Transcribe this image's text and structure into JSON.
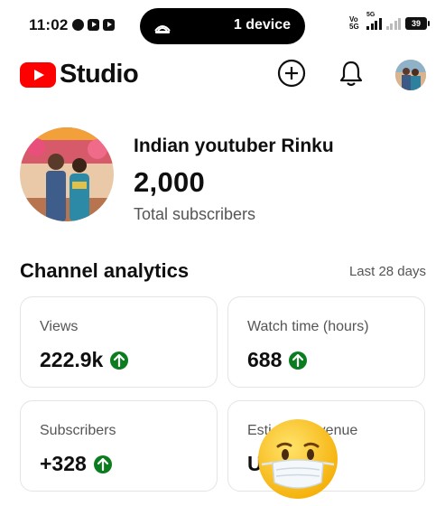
{
  "status_bar": {
    "time": "11:02",
    "cast_text": "1 device",
    "volte_label": "Vo\n5G R",
    "network_tag": "5G",
    "battery": "39"
  },
  "app": {
    "logo_text": "Studio",
    "brand_color": "#ff0000"
  },
  "channel": {
    "name": "Indian youtuber Rinku",
    "subscribers": "2,000",
    "subscribers_label": "Total subscribers"
  },
  "analytics": {
    "title": "Channel analytics",
    "period": "Last 28 days",
    "trend_color": "#0b7c1f",
    "cards": [
      {
        "label": "Views",
        "value": "222.9k",
        "trend": "up"
      },
      {
        "label": "Watch time (hours)",
        "value": "688",
        "trend": "up"
      },
      {
        "label": "Subscribers",
        "value": "+328",
        "trend": "up"
      },
      {
        "label": "Esti",
        "value": "U",
        "trend": "none"
      }
    ],
    "revenue_label_visible_tail": "venue"
  }
}
